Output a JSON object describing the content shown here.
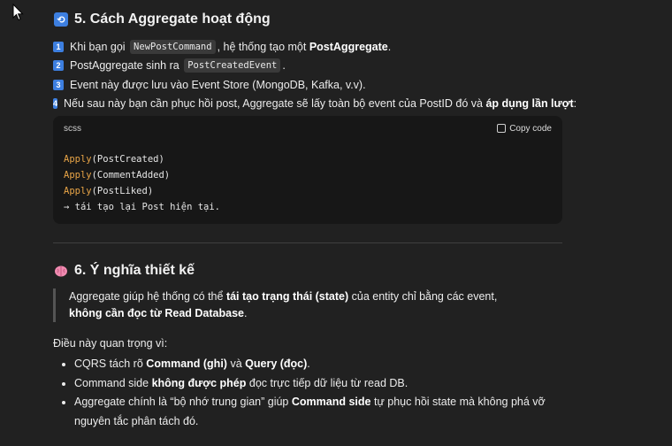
{
  "section5": {
    "icon": "repeat-icon",
    "title": "5. Cách Aggregate hoạt động",
    "steps": [
      {
        "num": "1",
        "pre": "Khi bạn gọi",
        "code": "NewPostCommand",
        "mid": ", hệ thống tạo một",
        "bold": "PostAggregate",
        "post": "."
      },
      {
        "num": "2",
        "pre": "PostAggregate sinh ra",
        "code": "PostCreatedEvent",
        "post": "."
      },
      {
        "num": "3",
        "text": "Event này được lưu vào Event Store (MongoDB, Kafka, v.v)."
      },
      {
        "num": "4",
        "pre": "Nếu sau này bạn cần phục hồi post, Aggregate sẽ lấy toàn bộ event của PostID đó và",
        "bold": "áp dụng lần lượt",
        "post": ":"
      }
    ],
    "code": {
      "lang": "scss",
      "copy_label": "Copy code",
      "lines": [
        {
          "kw": "Apply",
          "rest": "(PostCreated)"
        },
        {
          "kw": "Apply",
          "rest": "(CommentAdded)"
        },
        {
          "kw": "Apply",
          "rest": "(PostLiked)"
        },
        {
          "kw": "",
          "rest": "→ tái tạo lại Post hiện tại."
        }
      ]
    }
  },
  "section6": {
    "icon": "brain-icon",
    "title": "6. Ý nghĩa thiết kế",
    "quote": {
      "l1_pre": "Aggregate giúp hệ thống có thể",
      "l1_bold": "tái tạo trạng thái (state)",
      "l1_post": "của entity chỉ bằng các event,",
      "l2_bold": "không cần đọc từ Read Database",
      "l2_post": "."
    },
    "intro": "Điều này quan trọng vì:",
    "bullets": [
      {
        "pre": "CQRS tách rõ",
        "b1": "Command (ghi)",
        "mid": "và",
        "b2": "Query (đọc)",
        "post": "."
      },
      {
        "pre": "Command side",
        "b1": "không được phép",
        "mid": "đọc trực tiếp dữ liệu từ read DB.",
        "b2": "",
        "post": ""
      },
      {
        "pre": "Aggregate chính là “bộ nhớ trung gian” giúp",
        "b1": "Command side",
        "mid": "tự phục hồi state mà không phá vỡ nguyên tắc phân tách đó.",
        "b2": "",
        "post": ""
      }
    ]
  }
}
